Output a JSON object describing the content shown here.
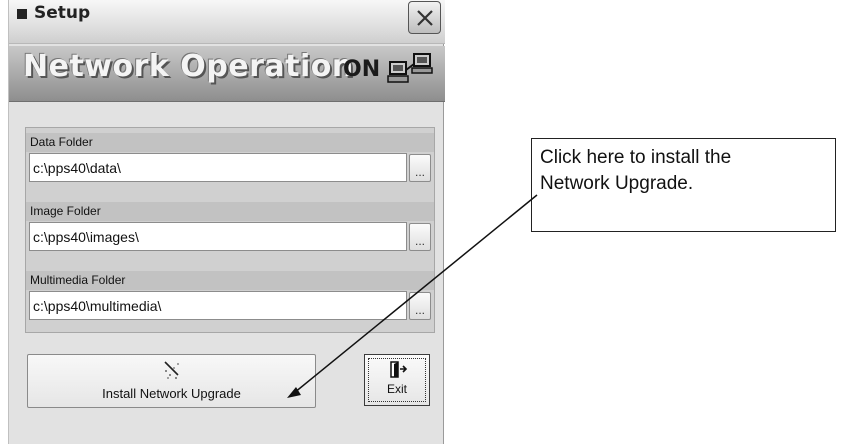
{
  "window": {
    "title": "Setup"
  },
  "banner": {
    "title": "Network Operation",
    "status": "ON"
  },
  "folders": [
    {
      "label": "Data Folder",
      "value": "c:\\pps40\\data\\",
      "browse": "..."
    },
    {
      "label": "Image Folder",
      "value": "c:\\pps40\\images\\",
      "browse": "..."
    },
    {
      "label": "Multimedia Folder",
      "value": "c:\\pps40\\multimedia\\",
      "browse": "..."
    }
  ],
  "buttons": {
    "install": "Install Network Upgrade",
    "exit": "Exit"
  },
  "callout": {
    "line1": "Click here to install the",
    "line2": "Network Upgrade."
  },
  "icons": {
    "window_icon": "window-icon",
    "close": "close-icon",
    "network": "network-computers-icon",
    "install": "sparkle-install-icon",
    "exit": "exit-door-icon"
  }
}
